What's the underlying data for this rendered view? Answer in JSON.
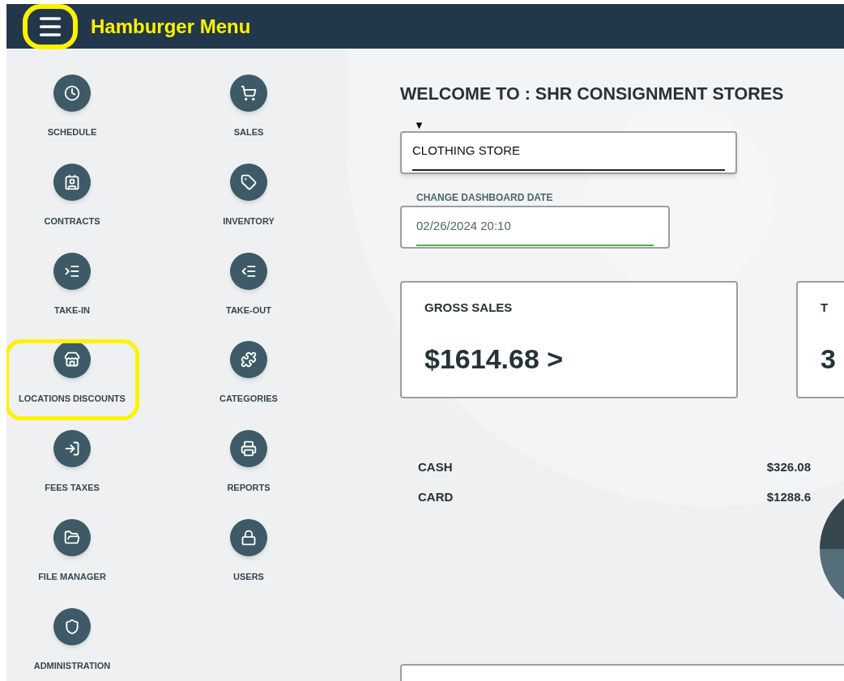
{
  "header": {
    "menu_button": {
      "highlighted": true
    },
    "annotation": "Hamburger Menu"
  },
  "menu_items": [
    {
      "label": "SCHEDULE",
      "highlighted": false
    },
    {
      "label": "SALES",
      "highlighted": false
    },
    {
      "label": "CONTRACTS",
      "highlighted": false
    },
    {
      "label": "INVENTORY",
      "highlighted": false
    },
    {
      "label": "TAKE-IN",
      "highlighted": false
    },
    {
      "label": "TAKE-OUT",
      "highlighted": false
    },
    {
      "label": "LOCATIONS DISCOUNTS",
      "highlighted": true
    },
    {
      "label": "CATEGORIES",
      "highlighted": false
    },
    {
      "label": "FEES TAXES",
      "highlighted": false
    },
    {
      "label": "REPORTS",
      "highlighted": false
    },
    {
      "label": "FILE MANAGER",
      "highlighted": false
    },
    {
      "label": "USERS",
      "highlighted": false
    },
    {
      "label": "ADMINISTRATION",
      "highlighted": false
    }
  ],
  "welcome_title": "WELCOME TO : SHR CONSIGNMENT STORES",
  "store_select": {
    "arrow": "▼",
    "value": "CLOTHING STORE"
  },
  "date_field": {
    "label": "CHANGE DASHBOARD DATE",
    "value": "02/26/2024 20:10",
    "focused": true
  },
  "cards": [
    {
      "title": "GROSS SALES",
      "value": "$1614.68 >"
    },
    {
      "title": "T",
      "value": "3"
    }
  ],
  "payments": [
    {
      "label": "CASH",
      "amount": "$326.08"
    },
    {
      "label": "CARD",
      "amount": "$1288.6"
    }
  ]
}
